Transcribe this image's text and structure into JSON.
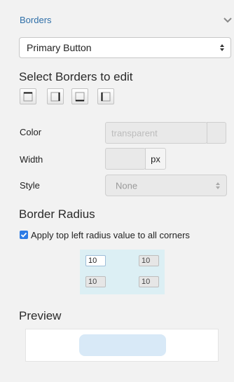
{
  "section": {
    "title": "Borders"
  },
  "button_select": {
    "value": "Primary Button"
  },
  "select_borders": {
    "title": "Select Borders to edit",
    "buttons": [
      "top-border-icon",
      "right-border-icon",
      "bottom-border-icon",
      "left-border-icon"
    ]
  },
  "color": {
    "label": "Color",
    "placeholder": "transparent"
  },
  "width": {
    "label": "Width",
    "unit": "px"
  },
  "style": {
    "label": "Style",
    "value": "None"
  },
  "border_radius": {
    "title": "Border Radius",
    "apply_all_label": "Apply top left radius value to all corners",
    "apply_all_checked": true,
    "values": {
      "top_left": "10",
      "top_right": "10",
      "bottom_left": "10",
      "bottom_right": "10"
    }
  },
  "preview": {
    "title": "Preview"
  },
  "colors": {
    "accent": "#2f6fa8",
    "checkbox": "#2c7be5",
    "preview_button": "#d8e9f7"
  }
}
